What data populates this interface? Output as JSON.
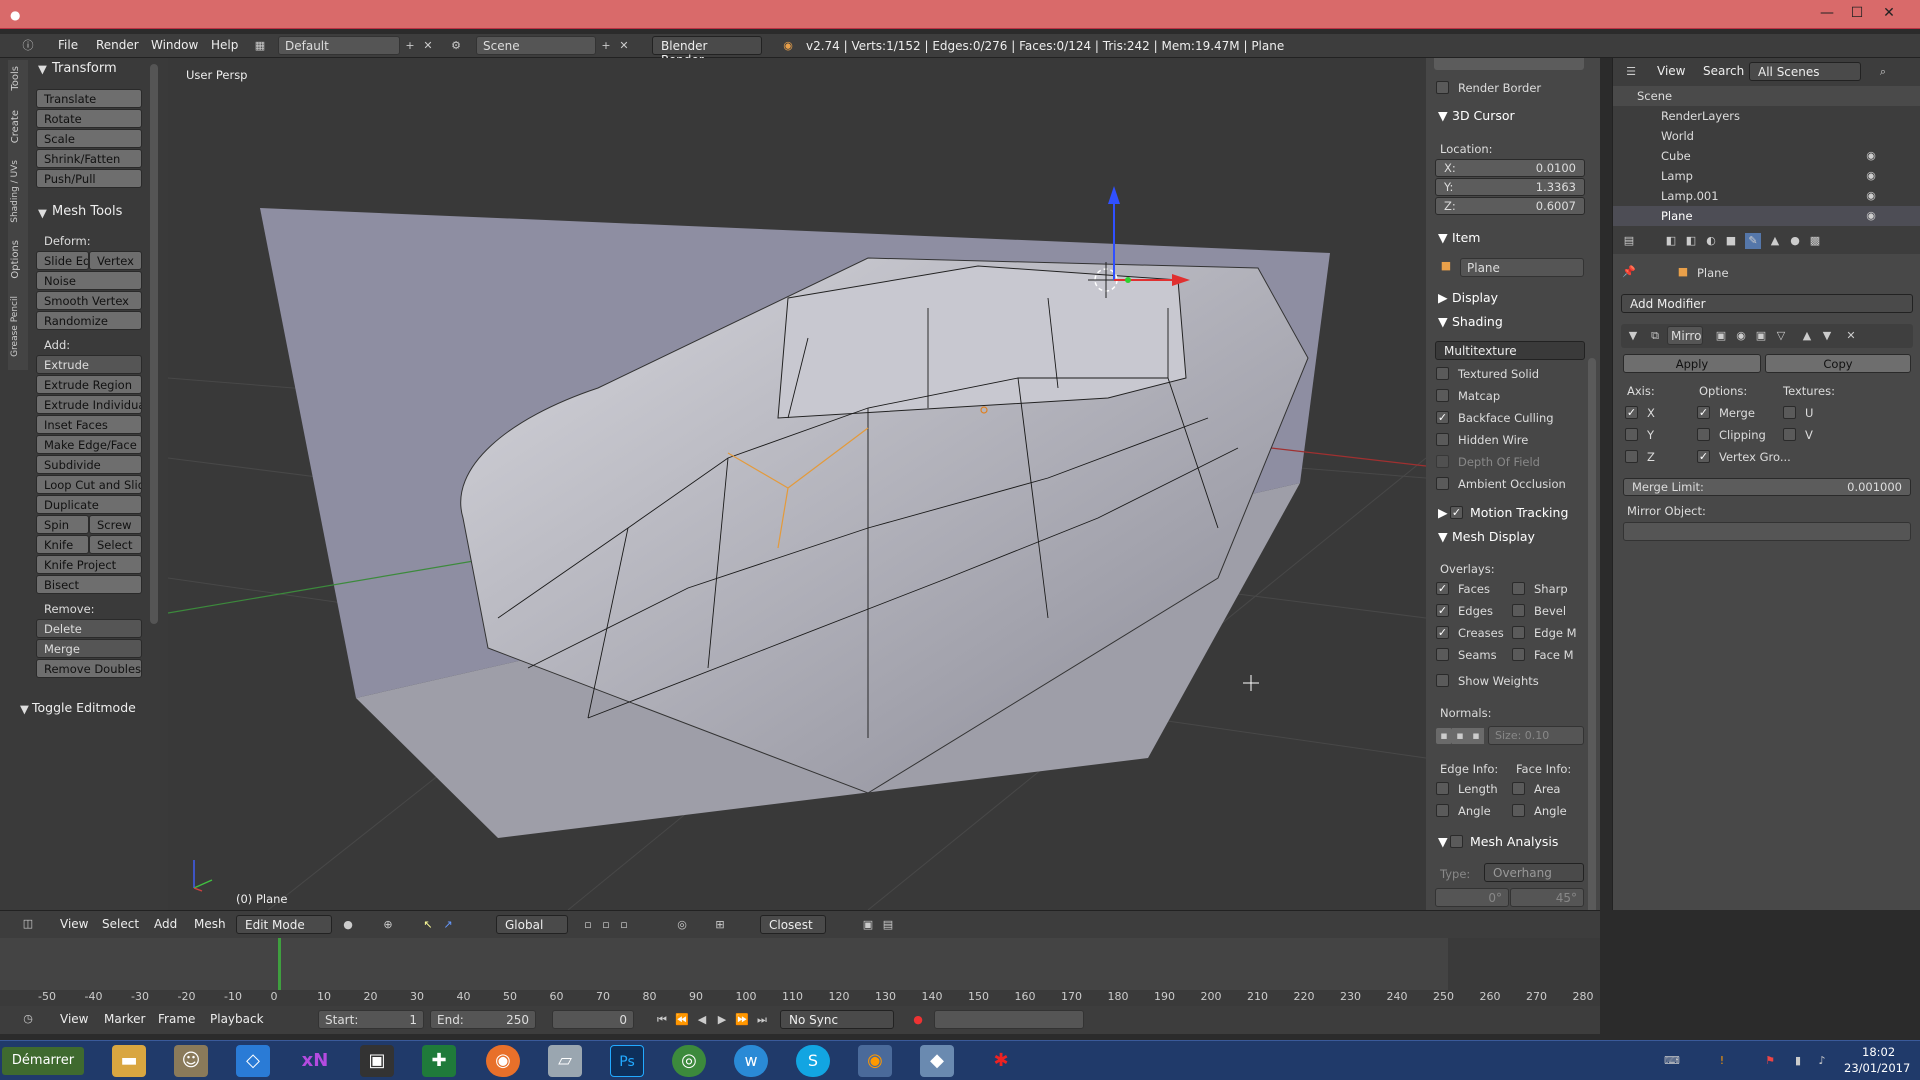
{
  "window": {
    "title_icon": "blender-icon",
    "min": "—",
    "max": "☐",
    "close": "✕"
  },
  "infobar": {
    "menus": [
      "File",
      "Render",
      "Window",
      "Help"
    ],
    "layout": "Default",
    "scene": "Scene",
    "engine": "Blender Render",
    "status": "v2.74 | Verts:1/152 | Edges:0/276 | Faces:0/124 | Tris:242 | Mem:19.47M | Plane"
  },
  "toolshelf": {
    "tabs": [
      "Tools",
      "Create",
      "Shading / UVs",
      "Options",
      "Grease Pencil"
    ],
    "transform_title": "Transform",
    "transform": [
      "Translate",
      "Rotate",
      "Scale",
      "Shrink/Fatten",
      "Push/Pull"
    ],
    "meshtools_title": "Mesh Tools",
    "deform_label": "Deform:",
    "deform_pair": [
      "Slide Ed",
      "Vertex"
    ],
    "deform": [
      "Noise",
      "Smooth Vertex",
      "Randomize"
    ],
    "add_label": "Add:",
    "extrude": "Extrude",
    "add": [
      "Extrude Region",
      "Extrude Individual",
      "Inset Faces",
      "Make Edge/Face",
      "Subdivide",
      "Loop Cut and Slide",
      "Duplicate"
    ],
    "spin_pair": [
      "Spin",
      "Screw"
    ],
    "knife_pair": [
      "Knife",
      "Select"
    ],
    "add2": [
      "Knife Project",
      "Bisect"
    ],
    "remove_label": "Remove:",
    "delete": "Delete",
    "merge": "Merge",
    "remove_doubles": "Remove Doubles",
    "toggle": "Toggle Editmode"
  },
  "viewport": {
    "persp": "User Persp",
    "object_label": "(0) Plane"
  },
  "props": {
    "render_border": "Render Border",
    "cursor_title": "3D Cursor",
    "location": "Location:",
    "x_label": "X:",
    "x": "0.0100",
    "y_label": "Y:",
    "y": "1.3363",
    "z_label": "Z:",
    "z": "0.6007",
    "item_title": "Item",
    "item_name": "Plane",
    "display_title": "Display",
    "shading_title": "Shading",
    "shading_mode": "Multitexture",
    "shading_opts": [
      "Textured Solid",
      "Matcap",
      "Backface Culling",
      "Hidden Wire",
      "Depth Of Field",
      "Ambient Occlusion"
    ],
    "motion_tracking": "Motion Tracking",
    "mesh_display": "Mesh Display",
    "overlays": "Overlays:",
    "ov_left": [
      "Faces",
      "Edges",
      "Creases",
      "Seams"
    ],
    "ov_right": [
      "Sharp",
      "Bevel",
      "Edge M",
      "Face M"
    ],
    "show_weights": "Show Weights",
    "normals": "Normals:",
    "size": "Size:",
    "size_val": "0.10",
    "edge_info": "Edge Info:",
    "face_info": "Face Info:",
    "length": "Length",
    "area": "Area",
    "angle1": "Angle",
    "angle2": "Angle",
    "mesh_analysis": "Mesh Analysis",
    "type_label": "Type:",
    "type_val": "Overhang",
    "min_angle": "0°",
    "max_angle": "45°"
  },
  "outliner": {
    "menus": [
      "View",
      "Search"
    ],
    "scenes": "All Scenes",
    "rows": [
      "Scene",
      "RenderLayers",
      "World",
      "Cube",
      "Lamp",
      "Lamp.001",
      "Plane"
    ]
  },
  "modifiers": {
    "object": "Plane",
    "add_modifier": "Add Modifier",
    "mod_name": "Mirro",
    "apply": "Apply",
    "copy": "Copy",
    "axis": "Axis:",
    "options": "Options:",
    "textures": "Textures:",
    "ax": [
      "X",
      "Y",
      "Z"
    ],
    "opts": [
      "Merge",
      "Clipping",
      "Vertex Gro..."
    ],
    "tex": [
      "U",
      "V"
    ],
    "merge_limit": "Merge Limit:",
    "merge_limit_val": "0.001000",
    "mirror_object": "Mirror Object:"
  },
  "vpheader": {
    "menus": [
      "View",
      "Select",
      "Add",
      "Mesh"
    ],
    "mode": "Edit Mode",
    "orientation": "Global",
    "snap": "Closest"
  },
  "timeline": {
    "ticks": [
      "-50",
      "-40",
      "-30",
      "-20",
      "-10",
      "0",
      "10",
      "20",
      "30",
      "40",
      "50",
      "60",
      "70",
      "80",
      "90",
      "100",
      "110",
      "120",
      "130",
      "140",
      "150",
      "160",
      "170",
      "180",
      "190",
      "200",
      "210",
      "220",
      "230",
      "240",
      "250",
      "260",
      "270",
      "280"
    ],
    "menus": [
      "View",
      "Marker",
      "Frame",
      "Playback"
    ],
    "start_label": "Start:",
    "start": "1",
    "end_label": "End:",
    "end": "250",
    "current": "0",
    "sync": "No Sync"
  },
  "taskbar": {
    "start": "Démarrer",
    "apps": [
      "explorer-icon",
      "gimp-icon",
      "dropbox-icon",
      "xnview-icon",
      "paint-icon",
      "excel-icon",
      "firefox-icon",
      "notes-icon",
      "photoshop-icon",
      "chrome-icon",
      "wunderlist-icon",
      "skype-icon",
      "blender-icon",
      "finder-icon",
      "app-red-icon"
    ],
    "ps_label": "Ps",
    "xn_label": "xN",
    "sk_label": "S",
    "w_label": "w",
    "time": "18:02",
    "date": "23/01/2017"
  }
}
